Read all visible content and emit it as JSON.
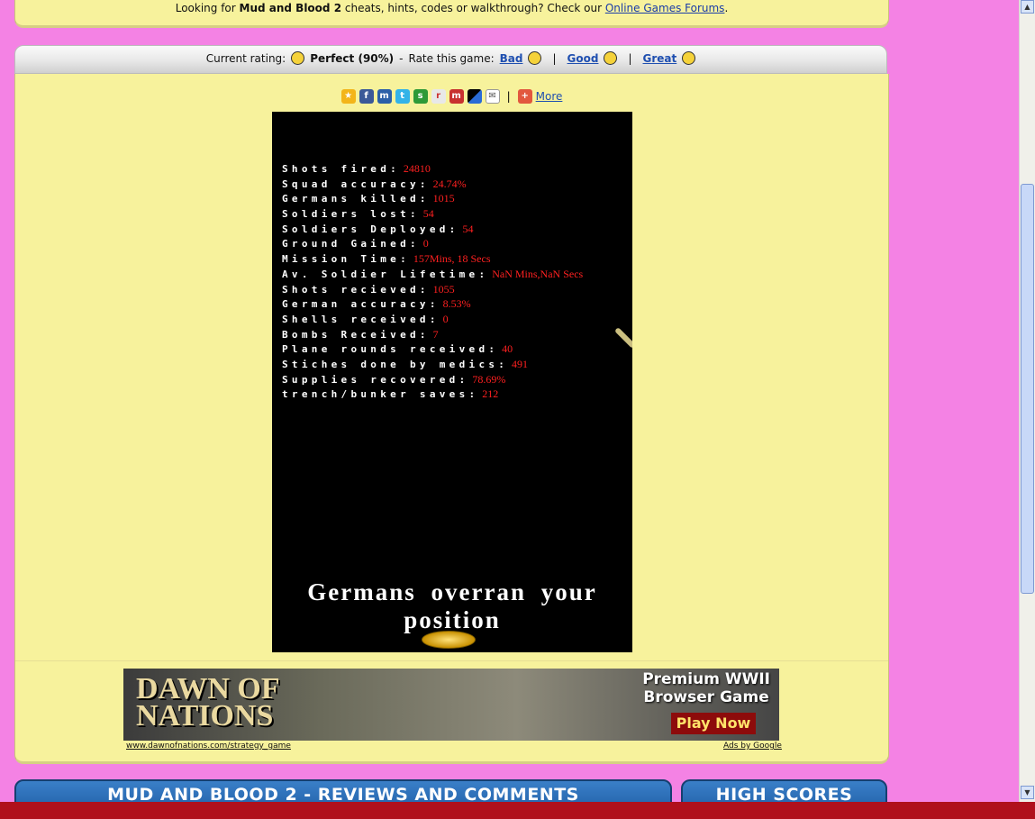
{
  "top_notice": {
    "prefix": "Looking for ",
    "game_name": "Mud and Blood 2",
    "middle": " cheats, hints, codes or walkthrough? Check our ",
    "link": "Online Games Forums",
    "suffix": "."
  },
  "rating": {
    "current_label": "Current rating:",
    "current_value": "Perfect (90%)",
    "dash": "-",
    "rate_label": "Rate this game:",
    "bad": "Bad",
    "good": "Good",
    "great": "Great",
    "sep": "|"
  },
  "share": {
    "icons": [
      "favorite-icon",
      "facebook-icon",
      "myspace-icon",
      "twitter-icon",
      "stumbleupon-icon",
      "reddit-icon",
      "mixx-icon",
      "delicious-icon",
      "email-icon"
    ],
    "more": "More"
  },
  "game": {
    "stats": [
      {
        "label": "Shots fired:",
        "value": "24810"
      },
      {
        "label": "Squad accuracy:",
        "value": "24.74%"
      },
      {
        "label": "Germans killed:",
        "value": "1015"
      },
      {
        "label": "Soldiers lost:",
        "value": "54"
      },
      {
        "label": "Soldiers Deployed:",
        "value": "54"
      },
      {
        "label": "Ground Gained:",
        "value": "0"
      },
      {
        "label": "Mission Time:",
        "value": "157Mins, 18 Secs"
      },
      {
        "label": "Av. Soldier Lifetime:",
        "value": "NaN Mins,NaN Secs"
      },
      {
        "label": "Shots recieved:",
        "value": "1055"
      },
      {
        "label": "German accuracy:",
        "value": "8.53%"
      },
      {
        "label": "Shells received:",
        "value": "0"
      },
      {
        "label": "Bombs Received:",
        "value": "7"
      },
      {
        "label": "Plane rounds received:",
        "value": "40"
      },
      {
        "label": "Stiches done by medics:",
        "value": "491"
      },
      {
        "label": "Supplies recovered:",
        "value": "78.69%"
      },
      {
        "label": "trench/bunker saves:",
        "value": "212"
      }
    ],
    "game_over_text": "Germans overran your position"
  },
  "ad": {
    "logo_line1": "DAWN OF",
    "logo_line2": "NATIONS",
    "tagline1": "Premium WWII",
    "tagline2": "Browser Game",
    "cta": "Play Now",
    "url": "www.dawnofnations.com/strategy_game",
    "ads_by": "Ads by Google"
  },
  "tabs": {
    "reviews": "MUD AND BLOOD 2 - REVIEWS AND COMMENTS",
    "high_scores": "HIGH SCORES"
  },
  "colors": {
    "page_bg": "#f482e4",
    "panel_bg": "#f7f29c",
    "stat_value": "#ff2020",
    "tab_blue": "#2b6db5",
    "bottom_strip": "#b0101c"
  }
}
